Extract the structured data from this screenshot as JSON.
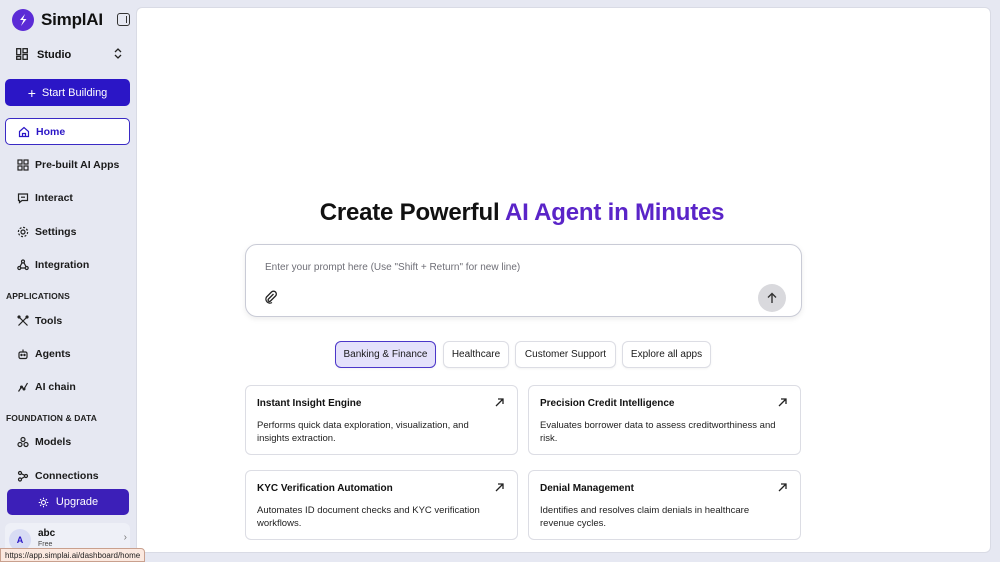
{
  "brand": {
    "name": "SimplAI"
  },
  "sidebar": {
    "workspace": "Studio",
    "start_building": "Start Building",
    "nav_top": [
      {
        "label": "Home",
        "icon": "home-icon",
        "active": true
      },
      {
        "label": "Pre-built AI Apps",
        "icon": "grid-icon"
      },
      {
        "label": "Interact",
        "icon": "chat-icon"
      },
      {
        "label": "Settings",
        "icon": "gear-icon"
      },
      {
        "label": "Integration",
        "icon": "integration-icon"
      }
    ],
    "section_applications": "APPLICATIONS",
    "nav_apps": [
      {
        "label": "Tools",
        "icon": "tools-icon"
      },
      {
        "label": "Agents",
        "icon": "agents-icon"
      },
      {
        "label": "AI chain",
        "icon": "chain-icon"
      }
    ],
    "section_foundation": "FOUNDATION & DATA",
    "nav_foundation": [
      {
        "label": "Models",
        "icon": "models-icon"
      },
      {
        "label": "Connections",
        "icon": "connections-icon"
      }
    ],
    "upgrade": "Upgrade",
    "user": {
      "initial": "A",
      "name": "abc",
      "plan": "Free"
    }
  },
  "main": {
    "headline_plain": "Create Powerful ",
    "headline_accent": "AI Agent in Minutes",
    "prompt_placeholder": "Enter your prompt here (Use \"Shift + Return\" for new line)",
    "chips": [
      {
        "label": "Banking & Finance",
        "active": true
      },
      {
        "label": "Healthcare"
      },
      {
        "label": "Customer Support"
      },
      {
        "label": "Explore all apps"
      }
    ],
    "cards": [
      {
        "title": "Instant Insight Engine",
        "desc": "Performs quick data exploration, visualization, and insights extraction."
      },
      {
        "title": "Precision Credit Intelligence",
        "desc": "Evaluates borrower data to assess creditworthiness and risk."
      },
      {
        "title": "KYC Verification Automation",
        "desc": "Automates ID document checks and KYC verification workflows."
      },
      {
        "title": "Denial Management",
        "desc": "Identifies and resolves claim denials in healthcare revenue cycles."
      }
    ]
  },
  "status_bar": {
    "url": "https://app.simplai.ai/dashboard/home"
  },
  "colors": {
    "accent": "#2b16c6",
    "headline_accent": "#5a24c8",
    "upgrade": "#3c1fb8"
  }
}
